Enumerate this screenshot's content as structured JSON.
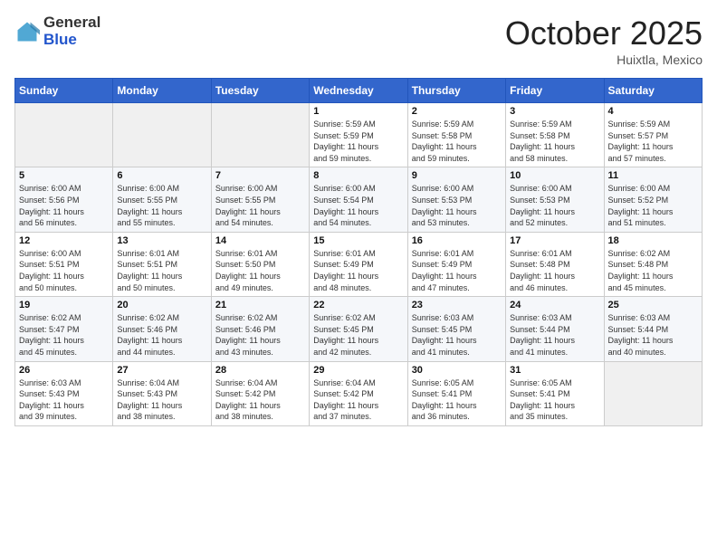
{
  "header": {
    "logo_general": "General",
    "logo_blue": "Blue",
    "month": "October 2025",
    "location": "Huixtla, Mexico"
  },
  "weekdays": [
    "Sunday",
    "Monday",
    "Tuesday",
    "Wednesday",
    "Thursday",
    "Friday",
    "Saturday"
  ],
  "weeks": [
    [
      {
        "day": "",
        "info": ""
      },
      {
        "day": "",
        "info": ""
      },
      {
        "day": "",
        "info": ""
      },
      {
        "day": "1",
        "info": "Sunrise: 5:59 AM\nSunset: 5:59 PM\nDaylight: 11 hours\nand 59 minutes."
      },
      {
        "day": "2",
        "info": "Sunrise: 5:59 AM\nSunset: 5:58 PM\nDaylight: 11 hours\nand 59 minutes."
      },
      {
        "day": "3",
        "info": "Sunrise: 5:59 AM\nSunset: 5:58 PM\nDaylight: 11 hours\nand 58 minutes."
      },
      {
        "day": "4",
        "info": "Sunrise: 5:59 AM\nSunset: 5:57 PM\nDaylight: 11 hours\nand 57 minutes."
      }
    ],
    [
      {
        "day": "5",
        "info": "Sunrise: 6:00 AM\nSunset: 5:56 PM\nDaylight: 11 hours\nand 56 minutes."
      },
      {
        "day": "6",
        "info": "Sunrise: 6:00 AM\nSunset: 5:55 PM\nDaylight: 11 hours\nand 55 minutes."
      },
      {
        "day": "7",
        "info": "Sunrise: 6:00 AM\nSunset: 5:55 PM\nDaylight: 11 hours\nand 54 minutes."
      },
      {
        "day": "8",
        "info": "Sunrise: 6:00 AM\nSunset: 5:54 PM\nDaylight: 11 hours\nand 54 minutes."
      },
      {
        "day": "9",
        "info": "Sunrise: 6:00 AM\nSunset: 5:53 PM\nDaylight: 11 hours\nand 53 minutes."
      },
      {
        "day": "10",
        "info": "Sunrise: 6:00 AM\nSunset: 5:53 PM\nDaylight: 11 hours\nand 52 minutes."
      },
      {
        "day": "11",
        "info": "Sunrise: 6:00 AM\nSunset: 5:52 PM\nDaylight: 11 hours\nand 51 minutes."
      }
    ],
    [
      {
        "day": "12",
        "info": "Sunrise: 6:00 AM\nSunset: 5:51 PM\nDaylight: 11 hours\nand 50 minutes."
      },
      {
        "day": "13",
        "info": "Sunrise: 6:01 AM\nSunset: 5:51 PM\nDaylight: 11 hours\nand 50 minutes."
      },
      {
        "day": "14",
        "info": "Sunrise: 6:01 AM\nSunset: 5:50 PM\nDaylight: 11 hours\nand 49 minutes."
      },
      {
        "day": "15",
        "info": "Sunrise: 6:01 AM\nSunset: 5:49 PM\nDaylight: 11 hours\nand 48 minutes."
      },
      {
        "day": "16",
        "info": "Sunrise: 6:01 AM\nSunset: 5:49 PM\nDaylight: 11 hours\nand 47 minutes."
      },
      {
        "day": "17",
        "info": "Sunrise: 6:01 AM\nSunset: 5:48 PM\nDaylight: 11 hours\nand 46 minutes."
      },
      {
        "day": "18",
        "info": "Sunrise: 6:02 AM\nSunset: 5:48 PM\nDaylight: 11 hours\nand 45 minutes."
      }
    ],
    [
      {
        "day": "19",
        "info": "Sunrise: 6:02 AM\nSunset: 5:47 PM\nDaylight: 11 hours\nand 45 minutes."
      },
      {
        "day": "20",
        "info": "Sunrise: 6:02 AM\nSunset: 5:46 PM\nDaylight: 11 hours\nand 44 minutes."
      },
      {
        "day": "21",
        "info": "Sunrise: 6:02 AM\nSunset: 5:46 PM\nDaylight: 11 hours\nand 43 minutes."
      },
      {
        "day": "22",
        "info": "Sunrise: 6:02 AM\nSunset: 5:45 PM\nDaylight: 11 hours\nand 42 minutes."
      },
      {
        "day": "23",
        "info": "Sunrise: 6:03 AM\nSunset: 5:45 PM\nDaylight: 11 hours\nand 41 minutes."
      },
      {
        "day": "24",
        "info": "Sunrise: 6:03 AM\nSunset: 5:44 PM\nDaylight: 11 hours\nand 41 minutes."
      },
      {
        "day": "25",
        "info": "Sunrise: 6:03 AM\nSunset: 5:44 PM\nDaylight: 11 hours\nand 40 minutes."
      }
    ],
    [
      {
        "day": "26",
        "info": "Sunrise: 6:03 AM\nSunset: 5:43 PM\nDaylight: 11 hours\nand 39 minutes."
      },
      {
        "day": "27",
        "info": "Sunrise: 6:04 AM\nSunset: 5:43 PM\nDaylight: 11 hours\nand 38 minutes."
      },
      {
        "day": "28",
        "info": "Sunrise: 6:04 AM\nSunset: 5:42 PM\nDaylight: 11 hours\nand 38 minutes."
      },
      {
        "day": "29",
        "info": "Sunrise: 6:04 AM\nSunset: 5:42 PM\nDaylight: 11 hours\nand 37 minutes."
      },
      {
        "day": "30",
        "info": "Sunrise: 6:05 AM\nSunset: 5:41 PM\nDaylight: 11 hours\nand 36 minutes."
      },
      {
        "day": "31",
        "info": "Sunrise: 6:05 AM\nSunset: 5:41 PM\nDaylight: 11 hours\nand 35 minutes."
      },
      {
        "day": "",
        "info": ""
      }
    ]
  ]
}
